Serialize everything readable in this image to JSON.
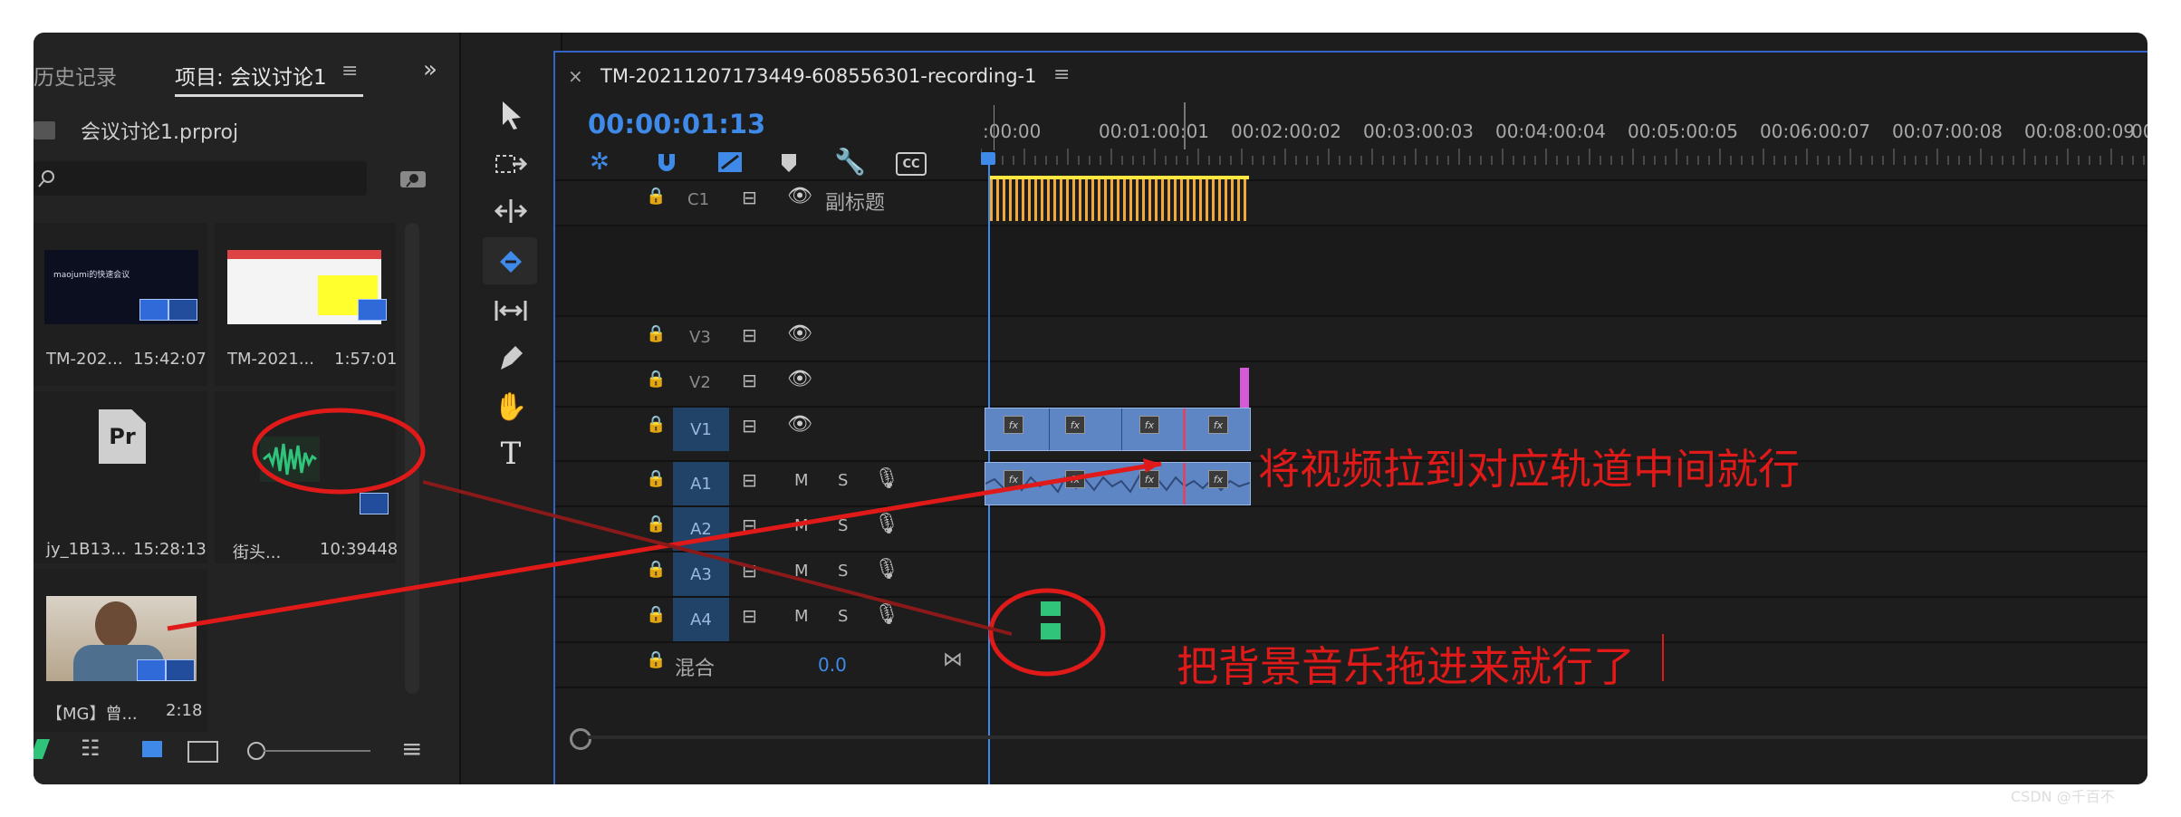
{
  "left_panel": {
    "tabs": [
      "历史记录",
      "项目: 会议讨论1"
    ],
    "project_file": "会议讨论1.prproj",
    "items": [
      {
        "name": "TM-202...",
        "duration": "15:42:07",
        "thumb_title": "maojumi的快速会议"
      },
      {
        "name": "TM-2021...",
        "duration": "1:57:01"
      },
      {
        "name": "jy_1B13...",
        "duration": "15:28:13",
        "icon_text": "Pr"
      },
      {
        "name": "街头...",
        "duration": "10:39448"
      },
      {
        "name": "【MG】曾...",
        "duration": "2:18"
      }
    ]
  },
  "timeline": {
    "sequence_title": "TM-20211207173449-608556301-recording-1",
    "timecode": "00:00:01:13",
    "ruler": [
      ":00:00",
      "00:01:00:01",
      "00:02:00:02",
      "00:03:00:03",
      "00:04:00:04",
      "00:05:00:05",
      "00:06:00:07",
      "00:07:00:08",
      "00:08:00:09",
      "00:"
    ],
    "tracks": {
      "caption": {
        "name": "C1",
        "label": "副标题"
      },
      "video": [
        "V3",
        "V2",
        "V1"
      ],
      "audio": [
        "A1",
        "A2",
        "A3",
        "A4"
      ],
      "mute": "M",
      "solo": "S",
      "mix_label": "混合",
      "mix_value": "0.0"
    },
    "fx_label": "fx"
  },
  "annotations": {
    "drag_video": "将视频拉到对应轨道中间就行",
    "drag_music": "把背景音乐拖进来就行了"
  },
  "watermark": "CSDN @千百不",
  "colors": {
    "accent": "#3f8ae8",
    "annotation": "#e01919",
    "caption_clip": "#f2a93b",
    "audio_clip": "#2fc47a"
  }
}
